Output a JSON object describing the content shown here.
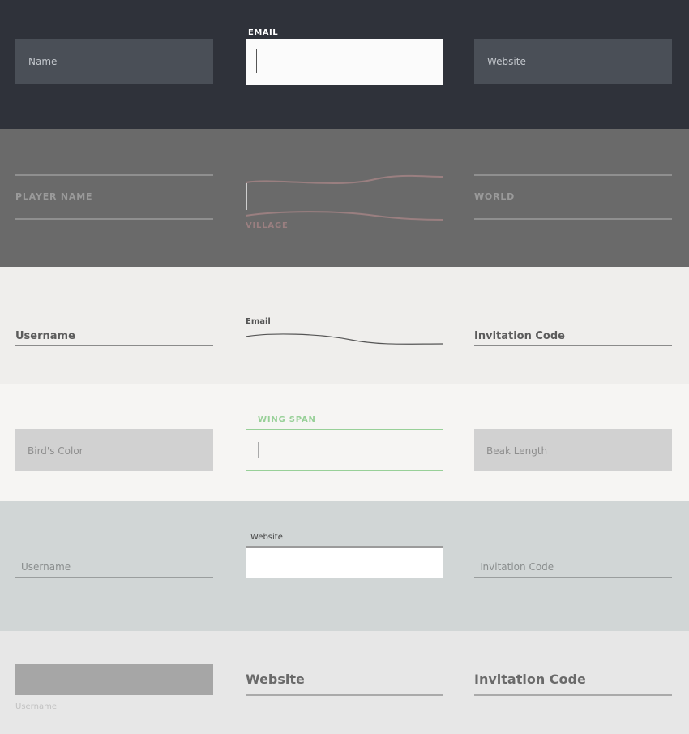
{
  "section1": {
    "name_placeholder": "Name",
    "email_label": "EMAIL",
    "website_placeholder": "Website"
  },
  "section2": {
    "player_label": "PLAYER NAME",
    "village_label": "VILLAGE",
    "world_label": "WORLD"
  },
  "section3": {
    "username_label": "Username",
    "email_label": "Email",
    "invitation_label": "Invitation Code"
  },
  "section4": {
    "bird_color_placeholder": "Bird's Color",
    "wing_span_label": "WING SPAN",
    "beak_length_placeholder": "Beak Length"
  },
  "section5": {
    "username_label": "Username",
    "website_label": "Website",
    "invitation_label": "Invitation Code"
  },
  "section6": {
    "username_label": "Username",
    "website_label": "Website",
    "invitation_label": "Invitation Code"
  },
  "colors": {
    "dark_bg": "#2f323a",
    "gray_bg": "#6a6a6a",
    "light_bg": "#efeeec",
    "offwhite_bg": "#f6f5f3",
    "blue_gray_bg": "#d1d6d6",
    "pale_gray_bg": "#e7e7e7",
    "wing_span_accent": "#98d098",
    "village_accent": "#9a7f80"
  }
}
